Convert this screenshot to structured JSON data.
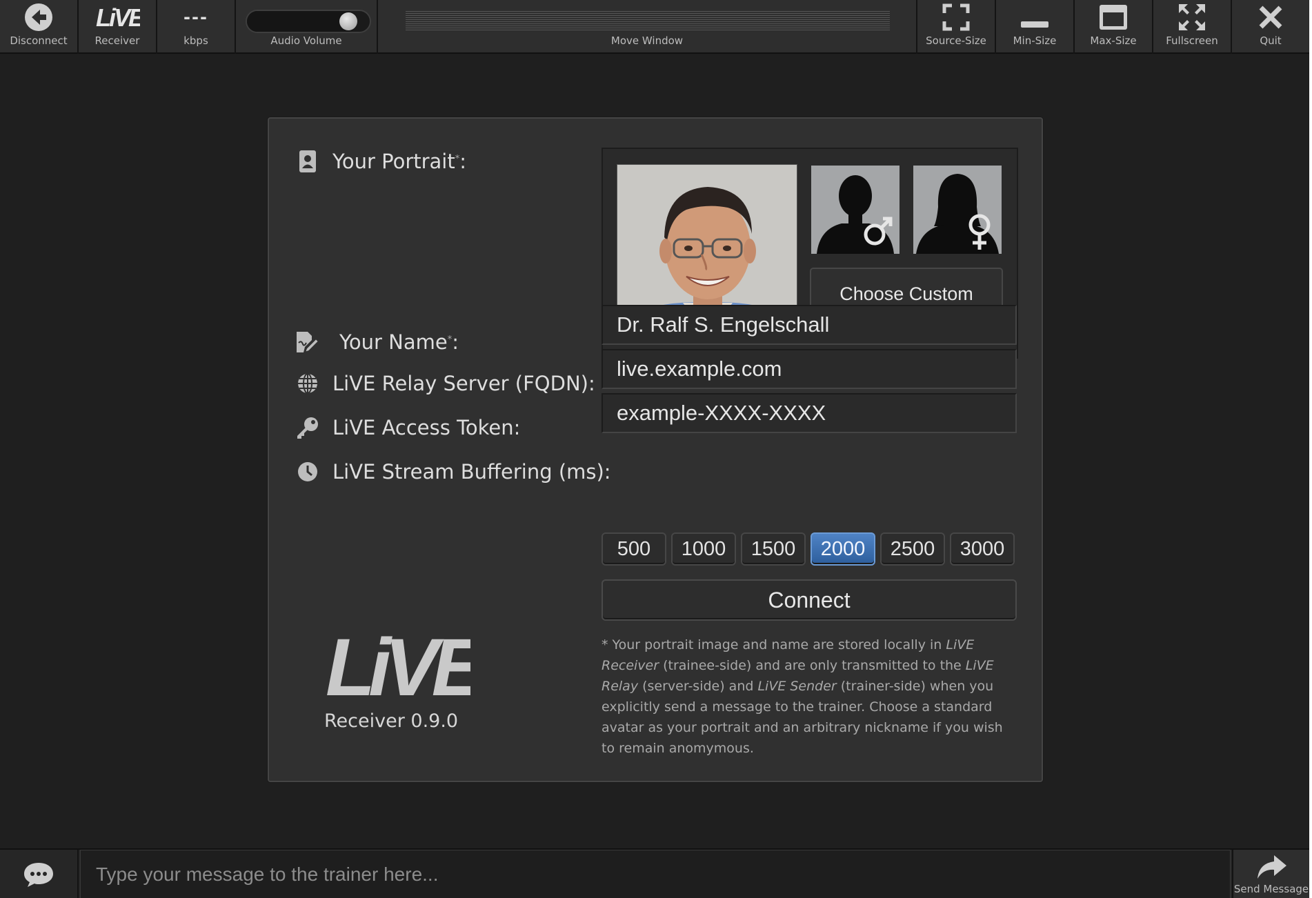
{
  "toolbar": {
    "disconnect": "Disconnect",
    "receiver": "Receiver",
    "kbps_value": "---",
    "kbps": "kbps",
    "audio_volume": "Audio Volume",
    "audio_volume_level": 0.88,
    "move_window": "Move Window",
    "source_size": "Source-Size",
    "min_size": "Min-Size",
    "max_size": "Max-Size",
    "fullscreen": "Fullscreen",
    "quit": "Quit",
    "logo_text": "LiVE"
  },
  "form": {
    "portrait_label": "Your Portrait",
    "portrait_asterisk": "*",
    "portrait_colon": ":",
    "choose_custom": "Choose Custom Portrait Image",
    "name_label": "Your Name",
    "name_asterisk": "*",
    "name_colon": ":",
    "name_value": "Dr. Ralf S. Engelschall",
    "relay_label": "LiVE Relay Server (FQDN):",
    "relay_value": "live.example.com",
    "token_label": "LiVE Access Token:",
    "token_value": "example-XXXX-XXXX",
    "buffering_label": "LiVE Stream Buffering (ms):",
    "buffering_options": [
      "500",
      "1000",
      "1500",
      "2000",
      "2500",
      "3000"
    ],
    "buffering_selected": "2000",
    "connect": "Connect",
    "note": {
      "p1": "* Your portrait image and name are stored locally in ",
      "i1": "LiVE Receiver",
      "p2": " (trainee-side) and are only transmitted to the ",
      "i2": "LiVE Relay",
      "p3": " (server-side) and ",
      "i3": "LiVE Sender",
      "p4": " (trainer-side) when you explicitly send a message to the trainer. Choose a standard avatar as your portrait and an arbitrary nickname if you wish to remain anomymous."
    },
    "logo_text": "LiVE",
    "logo_version": "Receiver 0.9.0"
  },
  "chat": {
    "placeholder": "Type your message to the trainer here...",
    "send": "Send Message"
  },
  "icons": {
    "disconnect": "arrow-left-circle-icon",
    "source_size": "corners-icon",
    "min_size": "minus-bar-icon",
    "max_size": "window-maximize-icon",
    "fullscreen": "expand-arrows-icon",
    "quit": "close-icon",
    "portrait": "id-card-icon",
    "name": "signature-icon",
    "relay": "globe-icon",
    "token": "key-icon",
    "buffering": "clock-icon",
    "chat": "chat-bubble-icon",
    "send": "share-arrow-icon"
  },
  "colors": {
    "background": "#1f1f1f",
    "panel": "#303030",
    "toolbar": "#2e2e2e",
    "accent": "#3f72b3"
  }
}
